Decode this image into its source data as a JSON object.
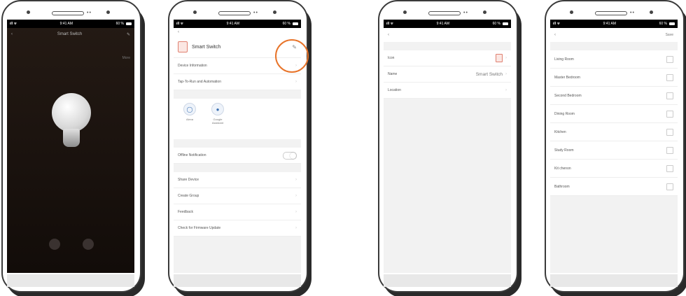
{
  "status": {
    "time": "9:41 AM",
    "battery": "60 %"
  },
  "screen1": {
    "title": "Smart Switch",
    "more": "More",
    "state": ""
  },
  "screen2": {
    "device_name": "Smart Switch",
    "rows_a": [
      "Device Information",
      "Tap-To-Run and Automation"
    ],
    "section_third": "",
    "third_party": [
      "Alexa",
      "Google Assistant"
    ],
    "section_notify": "",
    "offline_label": "Offline Notification",
    "section_others": "",
    "rows_b": [
      "Share Device",
      "Create Group",
      "Feedback",
      "Check for Firmware Update"
    ]
  },
  "screen3": {
    "rows": [
      {
        "label": "Icon",
        "value": ""
      },
      {
        "label": "Name",
        "value": "Smart Switch"
      },
      {
        "label": "Location",
        "value": ""
      }
    ]
  },
  "screen4": {
    "save": "Save",
    "rooms": [
      "Living Room",
      "Master Bedroom",
      "Second Bedroom",
      "Dining Room",
      "Kitchen",
      "Study Room",
      "Kit chenon",
      "Bathroom"
    ]
  }
}
